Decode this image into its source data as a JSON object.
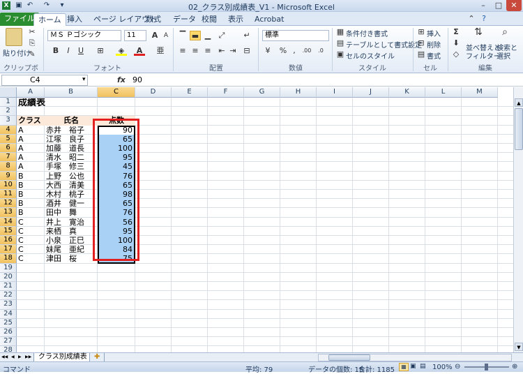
{
  "window": {
    "title": "02_クラス別成績表_V1 - Microsoft Excel",
    "min": "–",
    "max": "□",
    "close": "✕"
  },
  "tabs": [
    "ファイル",
    "ホーム",
    "挿入",
    "ページ レイアウト",
    "数式",
    "データ",
    "校閲",
    "表示",
    "Acrobat"
  ],
  "ribbon": {
    "clipboard": {
      "paste": "貼り付け",
      "label": "クリップボード"
    },
    "font": {
      "name": "ＭＳ Ｐゴシック",
      "size": "11",
      "grow": "A",
      "shrink": "A",
      "bold": "B",
      "italic": "I",
      "underline": "U",
      "label": "フォント"
    },
    "align": {
      "label": "配置"
    },
    "number": {
      "format": "標準",
      "label": "数値"
    },
    "styles": {
      "cond": "条件付き書式",
      "table": "テーブルとして書式設定",
      "cell": "セルのスタイル",
      "label": "スタイル"
    },
    "cells": {
      "insert": "挿入",
      "delete": "削除",
      "format": "書式",
      "label": "セル"
    },
    "edit": {
      "sum": "Σ",
      "sort": "並べ替えと",
      "sort2": "フィルター",
      "find": "検索と",
      "find2": "選択",
      "label": "編集"
    }
  },
  "formula_bar": {
    "name_box": "C4",
    "fx": "fx",
    "value": "90"
  },
  "columns": [
    "A",
    "B",
    "C",
    "D",
    "E",
    "F",
    "G",
    "H",
    "I",
    "J",
    "K",
    "L",
    "M"
  ],
  "sheet": {
    "title": "成績表",
    "headers": [
      "クラス",
      "氏名",
      "点数"
    ],
    "rows": [
      [
        "A",
        "赤井　裕子",
        "90"
      ],
      [
        "A",
        "江塚　良子",
        "65"
      ],
      [
        "A",
        "加藤　道長",
        "100"
      ],
      [
        "A",
        "清水　昭二",
        "95"
      ],
      [
        "A",
        "手塚　修三",
        "45"
      ],
      [
        "B",
        "上野　公也",
        "76"
      ],
      [
        "B",
        "大西　清美",
        "65"
      ],
      [
        "B",
        "木村　桃子",
        "98"
      ],
      [
        "B",
        "酒井　健一",
        "65"
      ],
      [
        "B",
        "田中　舞",
        "76"
      ],
      [
        "C",
        "井上　寛治",
        "56"
      ],
      [
        "C",
        "来栖　真",
        "95"
      ],
      [
        "C",
        "小泉　正巳",
        "100"
      ],
      [
        "C",
        "妹尾　亜紀",
        "84"
      ],
      [
        "C",
        "津田　桜",
        "75"
      ]
    ],
    "row_numbers": [
      "1",
      "2",
      "3",
      "4",
      "5",
      "6",
      "7",
      "8",
      "9",
      "10",
      "11",
      "12",
      "13",
      "14",
      "15",
      "16",
      "17",
      "18",
      "19",
      "20",
      "21",
      "22",
      "23",
      "24",
      "25",
      "26",
      "27",
      "28"
    ]
  },
  "sheet_tabs": {
    "active": "クラス別成績表",
    "nav": [
      "◀◀",
      "◀",
      "▶",
      "▶▶"
    ]
  },
  "status": {
    "mode": "コマンド",
    "average": "平均: 79",
    "count": "データの個数: 15",
    "sum": "合計: 1185",
    "zoom": "100%"
  }
}
